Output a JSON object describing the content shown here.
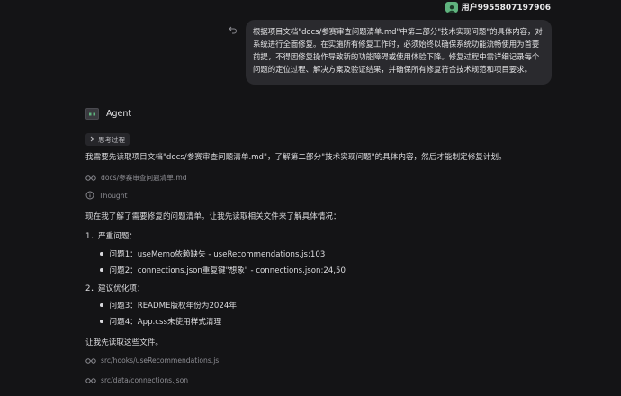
{
  "user": {
    "name": "用户9955807197906",
    "message": "根据项目文档\"docs/参赛审查问题清单.md\"中第二部分\"技术实现问题\"的具体内容，对系统进行全面修复。在实施所有修复工作时，必须始终以确保系统功能流畅使用为首要前提，不得因修复操作导致新的功能障碍或使用体验下降。修复过程中需详细记录每个问题的定位过程、解决方案及验证结果，并确保所有修复符合技术规范和项目要求。"
  },
  "agent": {
    "name": "Agent",
    "thinking_label": "思考过程",
    "intro": "我需要先读取项目文档\"docs/参赛审查问题清单.md\"，了解第二部分\"技术实现问题\"的具体内容，然后才能制定修复计划。",
    "tool_read_doc": "docs/参赛审查问题清单.md",
    "thought_label": "Thought",
    "understood": "现在我了解了需要修复的问题清单。让我先读取相关文件来了解具体情况：",
    "section1_title": "1．严重问题：",
    "section1_items": [
      "问题1：useMemo依赖缺失 - useRecommendations.js:103",
      "问题2：connections.json重复键\"想象\" - connections.json:24,50"
    ],
    "section2_title": "2．建议优化项：",
    "section2_items": [
      "问题3：README版权年份为2024年",
      "问题4：App.css未使用样式清理"
    ],
    "read_files": "让我先读取这些文件。",
    "tool_read_file1": "src/hooks/useRecommendations.js",
    "tool_read_file2": "src/data/connections.json"
  },
  "colors": {
    "accent": "#5fb37e",
    "bubble": "#2a2a2e",
    "background": "#141416"
  },
  "icons": [
    "person-icon",
    "undo-icon",
    "agent-icon",
    "chevron-right-icon",
    "glasses-icon",
    "info-icon"
  ]
}
